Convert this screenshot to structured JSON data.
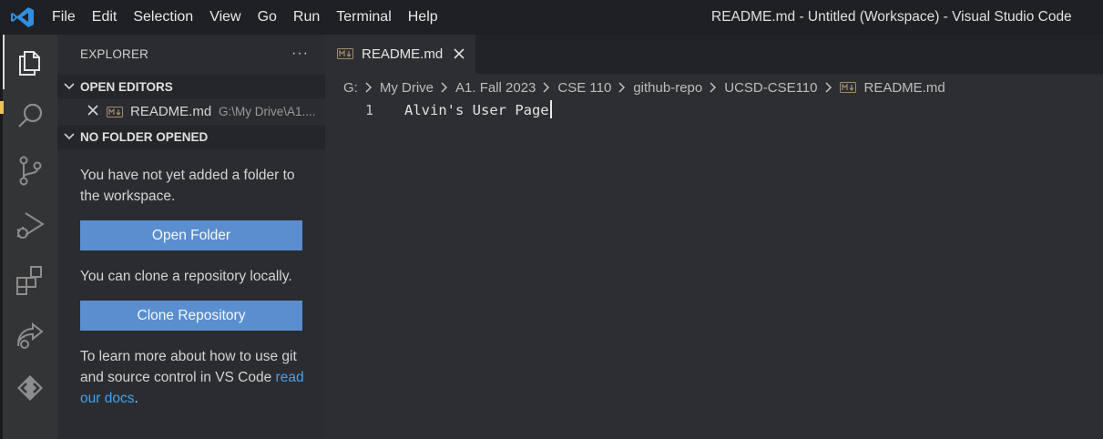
{
  "titlebar": {
    "menu": [
      "File",
      "Edit",
      "Selection",
      "View",
      "Go",
      "Run",
      "Terminal",
      "Help"
    ],
    "window_title": "README.md - Untitled (Workspace) - Visual Studio Code"
  },
  "activity_bar": {
    "items": [
      "explorer-icon",
      "search-icon",
      "source-control-icon",
      "run-debug-icon",
      "extensions-icon",
      "live-share-icon",
      "remote-icon"
    ],
    "active": "explorer-icon"
  },
  "sidebar": {
    "title": "EXPLORER",
    "more": "···",
    "open_editors": {
      "label": "OPEN EDITORS",
      "files": [
        {
          "name": "README.md",
          "path": "G:\\My Drive\\A1...."
        }
      ]
    },
    "no_folder": {
      "label": "NO FOLDER OPENED",
      "message": "You have not yet added a folder to the workspace.",
      "open_folder_button": "Open Folder",
      "clone_message": "You can clone a repository locally.",
      "clone_button": "Clone Repository",
      "learn_more": "To learn more about how to use git and source control in VS Code",
      "link_text": "read our docs",
      "link_suffix": "."
    }
  },
  "editor": {
    "tab": {
      "label": "README.md"
    },
    "breadcrumbs": [
      "G:",
      "My Drive",
      "A1. Fall 2023",
      "CSE 110",
      "github-repo",
      "UCSD-CSE110",
      "README.md"
    ],
    "lines": [
      {
        "number": "1",
        "text": "Alvin's User Page"
      }
    ]
  },
  "colors": {
    "accent_button": "#5b8ecf",
    "link": "#4aa0e8",
    "vscode_blue": "#2f8fe0"
  }
}
